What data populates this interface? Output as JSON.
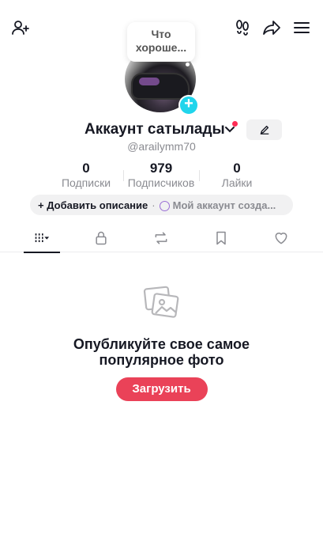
{
  "profile": {
    "bubble_text_1": "Что",
    "bubble_text_2": "хороше...",
    "display_name": "Аккаунт сатылады",
    "username": "@arailymm70"
  },
  "stats": [
    {
      "value": "0",
      "label": "Подписки"
    },
    {
      "value": "979",
      "label": "Подписчиков"
    },
    {
      "value": "0",
      "label": "Лайки"
    }
  ],
  "bio": {
    "add_label": "+ Добавить описание",
    "separator": "·",
    "my_account_label": "Мой аккаунт созда..."
  },
  "empty_state": {
    "title_line1": "Опубликуйте свое самое",
    "title_line2": "популярное фото",
    "upload_label": "Загрузить"
  },
  "colors": {
    "accent_red": "#ea4258",
    "badge_blue": "#20d5ec",
    "notification_dot": "#fe2c55"
  },
  "icons": {
    "top_left": "add-friend-icon",
    "top_right": [
      "footprints-icon",
      "share-icon",
      "menu-icon"
    ],
    "tabs": [
      "videos-grid-icon",
      "lock-icon",
      "repost-icon",
      "bookmark-icon",
      "heart-icon"
    ]
  }
}
